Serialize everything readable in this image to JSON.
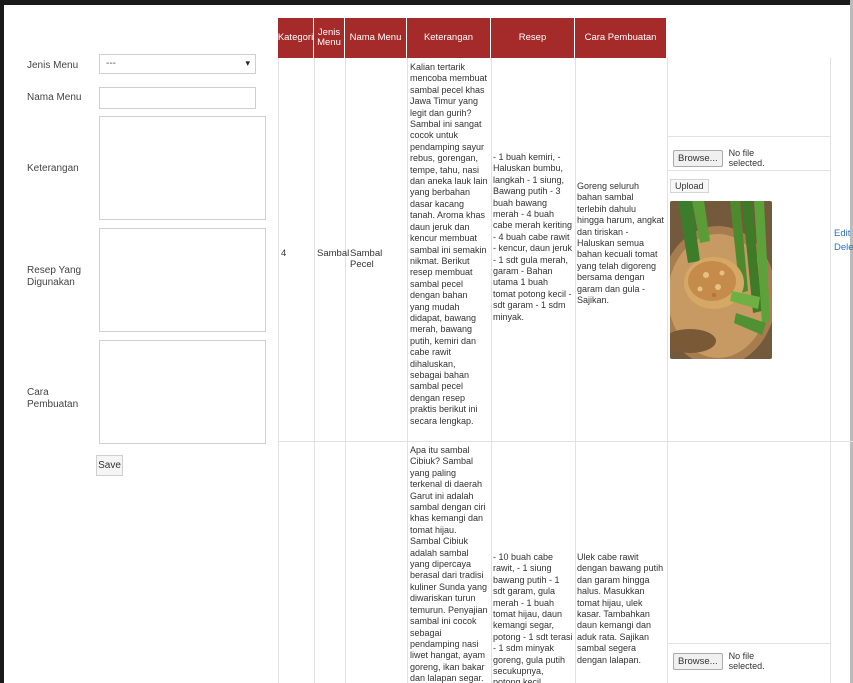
{
  "form": {
    "jenis_menu_label": "Jenis Menu",
    "jenis_menu_value": "---",
    "nama_menu_label": "Nama Menu",
    "keterangan_label": "Keterangan",
    "resep_label": "Resep Yang Digunakan",
    "cara_label": "Cara Pembuatan",
    "save_label": "Save"
  },
  "table": {
    "headers": [
      "Kategori",
      "Jenis Menu",
      "Nama Menu",
      "Keterangan",
      "Resep",
      "Cara Pembuatan"
    ],
    "rows": [
      {
        "kategori": "4",
        "jenis": "Sambal",
        "nama": "Sambal Pecel",
        "keterangan": "Kalian tertarik mencoba membuat sambal pecel khas Jawa Timur yang legit dan gurih? Sambal ini sangat cocok untuk pendamping sayur rebus, gorengan, tempe, tahu, nasi dan aneka lauk lain yang berbahan dasar kacang tanah. Aroma khas daun jeruk dan kencur membuat sambal ini semakin nikmat. Berikut resep membuat sambal pecel dengan bahan yang mudah didapat, bawang merah, bawang putih, kemiri dan cabe rawit dihaluskan, sebagai bahan sambal pecel dengan resep praktis berikut ini secara lengkap.",
        "resep": "- 1 buah kemiri, - Haluskan bumbu, langkah - 1 siung, Bawang putih - 3 buah bawang merah - 4 buah cabe merah keriting - 4 buah cabe rawit - kencur, daun jeruk - 1 sdt gula merah, garam - Bahan utama 1 buah tomat potong kecil - sdt garam - 1 sdm minyak.",
        "cara": "Goreng seluruh bahan sambal terlebih dahulu hingga harum, angkat dan tiriskan - Haluskan semua bahan kecuali tomat yang telah digoreng bersama dengan garam dan gula - Sajikan.",
        "browse_label": "Browse...",
        "no_file_label": "No file selected.",
        "upload_label": "Upload",
        "action_edit": "Edit",
        "action_delete": "Delete"
      },
      {
        "keterangan": "Apa itu sambal Cibiuk? Sambal yang paling terkenal di daerah Garut ini adalah sambal dengan ciri khas kemangi dan tomat hijau. Sambal Cibiuk adalah sambal yang dipercaya berasal dari tradisi kuliner Sunda yang diwariskan turun temurun. Penyajian sambal ini cocok sebagai pendamping nasi liwet hangat, ayam goreng, ikan bakar dan lalapan segar. Rasanya segar",
        "resep": "- 10 buah cabe rawit, - 1 siung bawang putih - 1 sdt garam, gula merah - 1 buah tomat hijau, daun kemangi segar, potong - 1 sdt terasi - 1 sdm minyak goreng, gula putih secukupnya, potong kecil.",
        "cara": "Ulek cabe rawit dengan bawang putih dan garam hingga halus. Masukkan tomat hijau, ulek kasar. Tambahkan daun kemangi dan aduk rata. Sajikan sambal segera dengan lalapan.",
        "browse_label": "Browse...",
        "no_file_label": "No file selected."
      }
    ]
  },
  "colors": {
    "header_bg": "#a52a2a",
    "link": "#2f6fb5"
  },
  "icons": {
    "select_caret": "caret-down-icon",
    "food_photo": "sambal-pecel-photo"
  }
}
